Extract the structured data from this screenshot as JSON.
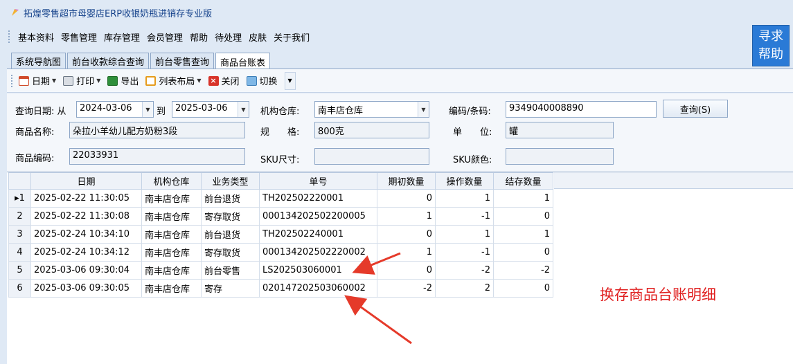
{
  "window": {
    "title": "拓煌零售超市母婴店ERP收银奶瓶进销存专业版"
  },
  "menu": [
    "基本资料",
    "零售管理",
    "库存管理",
    "会员管理",
    "帮助",
    "待处理",
    "皮肤",
    "关于我们"
  ],
  "help_button": {
    "line1": "寻求",
    "line2": "帮助"
  },
  "tabs": [
    "系统导航图",
    "前台收款综合查询",
    "前台零售查询",
    "商品台账表"
  ],
  "toolbar": {
    "date": "日期",
    "print": "打印",
    "export": "导出",
    "layout": "列表布局",
    "close": "关闭",
    "switch": "切换"
  },
  "query": {
    "date_label": "查询日期: 从",
    "date_from": "2024-03-06",
    "to_label": "到",
    "date_to": "2025-03-06",
    "warehouse_label": "机构仓库:",
    "warehouse_value": "南丰店仓库",
    "barcode_label": "编码/条码:",
    "barcode_value": "9349040008890",
    "query_button": "查询(S)",
    "name_label": "商品名称:",
    "name_value": "朵拉小羊幼儿配方奶粉3段",
    "spec_label": "规　　格:",
    "spec_value": "800克",
    "unit_label": "单　　位:",
    "unit_value": "罐",
    "code_label": "商品编码:",
    "code_value": "22033931",
    "sku_size_label": "SKU尺寸:",
    "sku_size_value": "",
    "sku_color_label": "SKU颜色:",
    "sku_color_value": ""
  },
  "grid": {
    "columns": [
      "日期",
      "机构仓库",
      "业务类型",
      "单号",
      "期初数量",
      "操作数量",
      "结存数量"
    ],
    "rows": [
      {
        "rn": "▸1",
        "date": "2025-02-22 11:30:05",
        "wh": "南丰店仓库",
        "type": "前台退货",
        "no": "TH202502220001",
        "open": "0",
        "op": "1",
        "bal": "1"
      },
      {
        "rn": "2",
        "date": "2025-02-22 11:30:08",
        "wh": "南丰店仓库",
        "type": "寄存取货",
        "no": "000134202502200005",
        "open": "1",
        "op": "-1",
        "bal": "0"
      },
      {
        "rn": "3",
        "date": "2025-02-24 10:34:10",
        "wh": "南丰店仓库",
        "type": "前台退货",
        "no": "TH202502240001",
        "open": "0",
        "op": "1",
        "bal": "1"
      },
      {
        "rn": "4",
        "date": "2025-02-24 10:34:12",
        "wh": "南丰店仓库",
        "type": "寄存取货",
        "no": "000134202502220002",
        "open": "1",
        "op": "-1",
        "bal": "0"
      },
      {
        "rn": "5",
        "date": "2025-03-06 09:30:04",
        "wh": "南丰店仓库",
        "type": "前台零售",
        "no": "LS202503060001",
        "open": "0",
        "op": "-2",
        "bal": "-2"
      },
      {
        "rn": "6",
        "date": "2025-03-06 09:30:05",
        "wh": "南丰店仓库",
        "type": "寄存",
        "no": "020147202503060002",
        "open": "-2",
        "op": "2",
        "bal": "0"
      }
    ]
  },
  "annotation": "换存商品台账明细",
  "colors": {
    "accent": "#2a7ad6",
    "annotation": "#e02020"
  }
}
